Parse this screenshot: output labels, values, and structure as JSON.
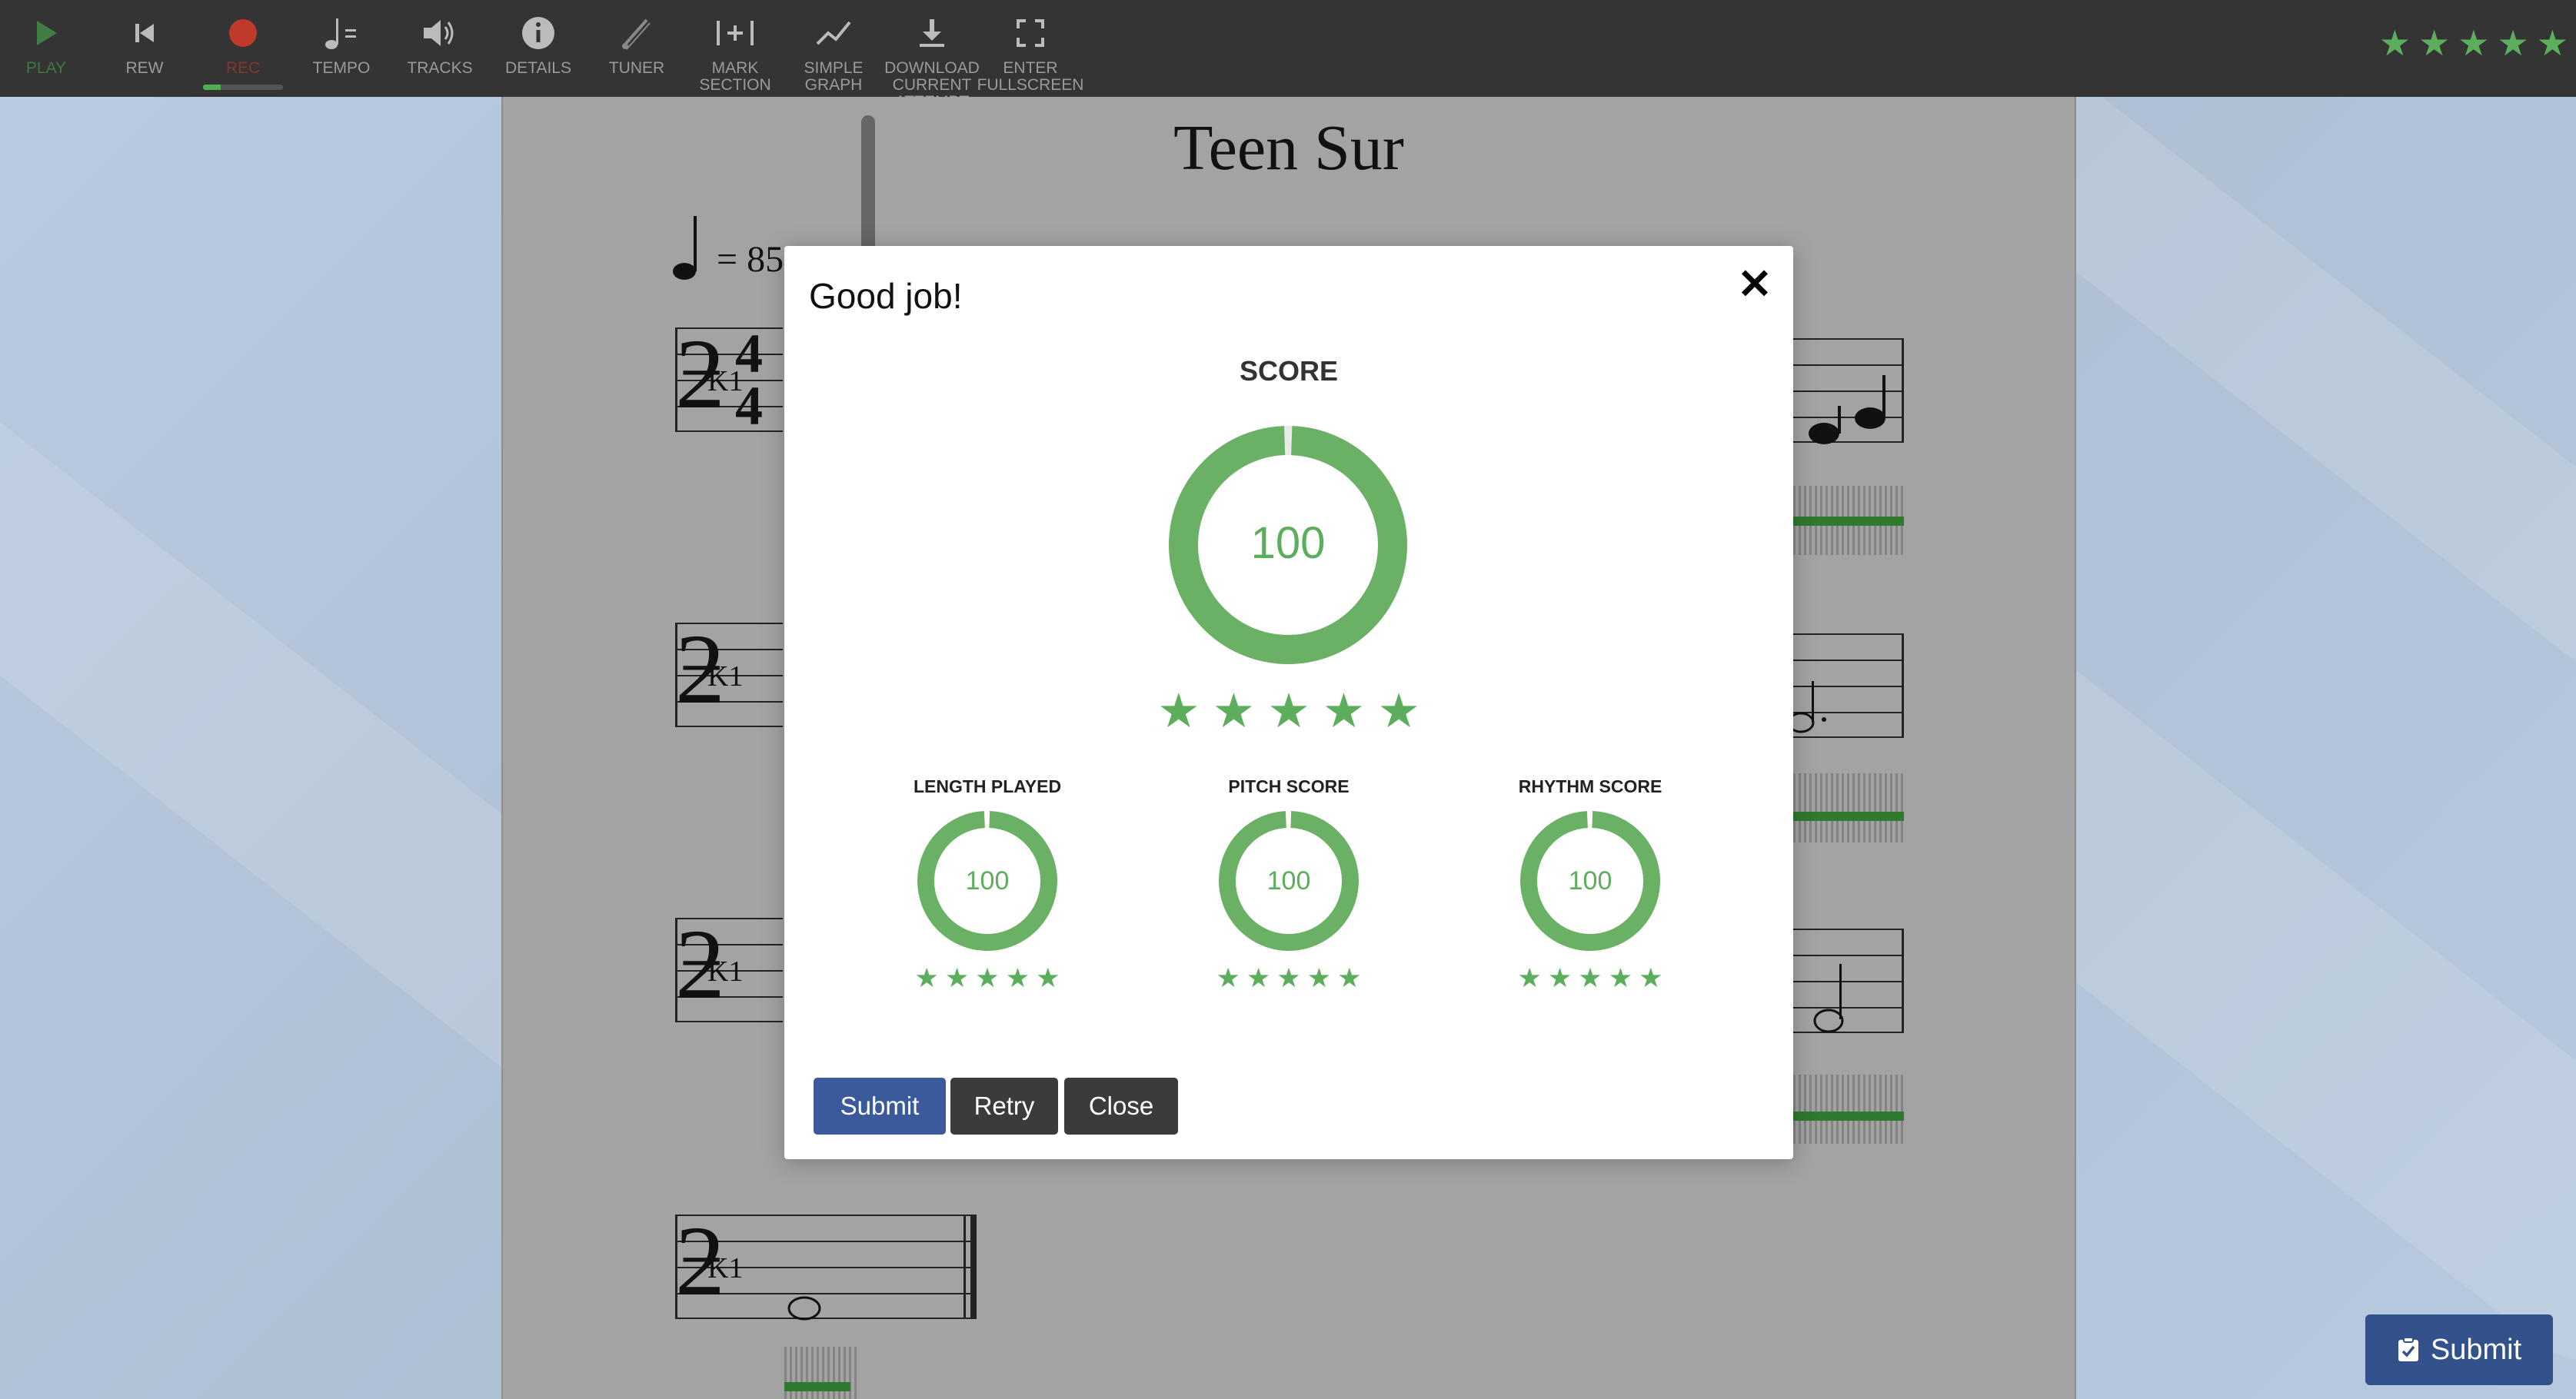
{
  "toolbar": {
    "items": [
      {
        "label": "PLAY",
        "icon": "play-icon"
      },
      {
        "label": "REW",
        "icon": "rewind-icon"
      },
      {
        "label": "REC",
        "icon": "record-icon"
      },
      {
        "label": "TEMPO",
        "icon": "tempo-icon"
      },
      {
        "label": "TRACKS",
        "icon": "speaker-icon"
      },
      {
        "label": "DETAILS",
        "icon": "info-icon"
      },
      {
        "label": "TUNER",
        "icon": "tuner-icon"
      },
      {
        "label": "MARK\nSECTION",
        "icon": "mark-section-icon"
      },
      {
        "label": "SIMPLE\nGRAPH",
        "icon": "graph-icon"
      },
      {
        "label": "DOWNLOAD\nCURRENT\nATTEMPT",
        "icon": "download-icon"
      },
      {
        "label": "ENTER\nFULLSCREEN",
        "icon": "fullscreen-icon"
      }
    ],
    "rating_stars": 5
  },
  "sheet": {
    "title": "Teen Sur",
    "tempo_value": "= 85",
    "clef_label": "K1",
    "time_signature": "4/4"
  },
  "modal": {
    "title": "Good job!",
    "close_symbol": "✕",
    "score_label": "SCORE",
    "overall_score": "100",
    "overall_stars": 5,
    "sub_scores": [
      {
        "label": "LENGTH PLAYED",
        "value": "100",
        "stars": 5
      },
      {
        "label": "PITCH SCORE",
        "value": "100",
        "stars": 5
      },
      {
        "label": "RHYTHM SCORE",
        "value": "100",
        "stars": 5
      }
    ],
    "buttons": {
      "submit": "Submit",
      "retry": "Retry",
      "close": "Close"
    }
  },
  "submit_fab": {
    "label": "Submit",
    "icon": "clipboard-check-icon"
  },
  "colors": {
    "accent_green": "#5cae5c",
    "toolbar_bg": "#343434",
    "primary_blue": "#3a5a9c",
    "dark_button": "#3b3b3b",
    "record_red": "#c0392b"
  }
}
